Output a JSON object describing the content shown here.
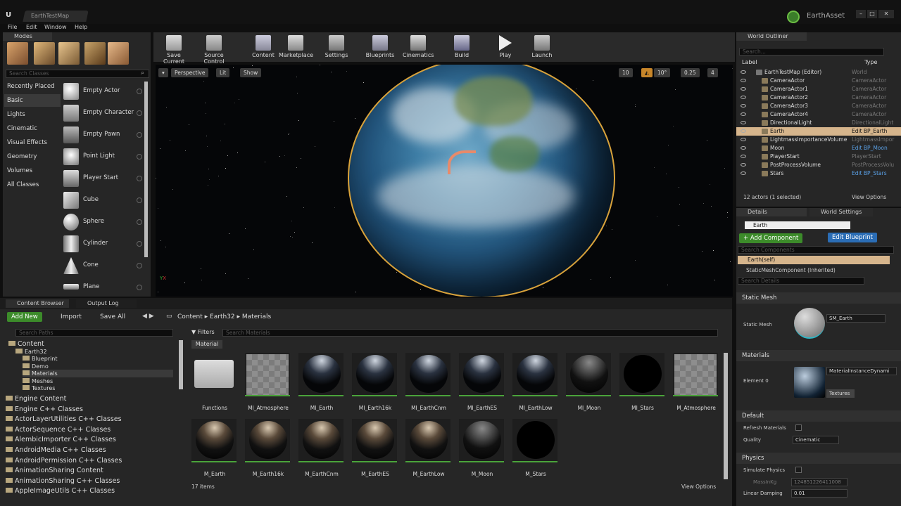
{
  "window": {
    "doc_tab": "EarthTestMap",
    "asset_name": "EarthAsset"
  },
  "menu": [
    "File",
    "Edit",
    "Window",
    "Help"
  ],
  "modes": {
    "tab": "Modes",
    "search_placeholder": "Search Classes",
    "categories": [
      "Recently Placed",
      "Basic",
      "Lights",
      "Cinematic",
      "Visual Effects",
      "Geometry",
      "Volumes",
      "All Classes"
    ],
    "active_category": "Basic",
    "items": [
      "Empty Actor",
      "Empty Character",
      "Empty Pawn",
      "Point Light",
      "Player Start",
      "Cube",
      "Sphere",
      "Cylinder",
      "Cone",
      "Plane"
    ]
  },
  "toolbar": [
    {
      "label": "Save Current",
      "icon": "save-icon"
    },
    {
      "label": "Source Control",
      "icon": "source-control-icon"
    },
    {
      "label": "Content",
      "icon": "content-icon"
    },
    {
      "label": "Marketplace",
      "icon": "marketplace-icon"
    },
    {
      "label": "Settings",
      "icon": "settings-icon"
    },
    {
      "label": "Blueprints",
      "icon": "blueprints-icon"
    },
    {
      "label": "Cinematics",
      "icon": "cinematics-icon"
    },
    {
      "label": "Build",
      "icon": "build-icon"
    },
    {
      "label": "Play",
      "icon": "play-icon"
    },
    {
      "label": "Launch",
      "icon": "launch-icon"
    }
  ],
  "viewport": {
    "perspective": "Perspective",
    "lit": "Lit",
    "show": "Show",
    "grid_snap": "10",
    "rot_snap": "10°",
    "scale_snap": "0.25",
    "cam_speed": "4"
  },
  "outliner": {
    "tab": "World Outliner",
    "search_placeholder": "Search...",
    "col_label": "Label",
    "col_type": "Type",
    "rows": [
      {
        "label": "EarthTestMap (Editor)",
        "type": "World"
      },
      {
        "label": "CameraActor",
        "type": "CameraActor"
      },
      {
        "label": "CameraActor1",
        "type": "CameraActor"
      },
      {
        "label": "CameraActor2",
        "type": "CameraActor"
      },
      {
        "label": "CameraActor3",
        "type": "CameraActor"
      },
      {
        "label": "CameraActor4",
        "type": "CameraActor"
      },
      {
        "label": "DirectionalLight",
        "type": "DirectionalLight"
      },
      {
        "label": "Earth",
        "type": "Edit BP_Earth"
      },
      {
        "label": "LightmassImportanceVolume",
        "type": "LightmassImpor"
      },
      {
        "label": "Moon",
        "type": "Edit BP_Moon"
      },
      {
        "label": "PlayerStart",
        "type": "PlayerStart"
      },
      {
        "label": "PostProcessVolume",
        "type": "PostProcessVolu"
      },
      {
        "label": "Stars",
        "type": "Edit BP_Stars"
      }
    ],
    "selected": "Earth",
    "footer": "12 actors (1 selected)",
    "view_options": "View Options"
  },
  "details": {
    "tab": "Details",
    "tab2": "World Settings",
    "name_value": "Earth",
    "add_component": "+ Add Component",
    "edit_blueprint": "Edit Blueprint",
    "search_components": "Search Components",
    "self": "Earth(self)",
    "component": "StaticMeshComponent (Inherited)",
    "search_details": "Search Details",
    "static_mesh_section": "Static Mesh",
    "static_mesh_label": "Static Mesh",
    "static_mesh_value": "SM_Earth",
    "materials_section": "Materials",
    "element_label": "Element 0",
    "element_value": "MaterialInstanceDynami",
    "textures": "Textures",
    "default_section": "Default",
    "refresh_materials": "Refresh Materials",
    "quality_label": "Quality",
    "quality_value": "Cinematic",
    "physics_section": "Physics",
    "simulate_physics": "Simulate Physics",
    "mass_label": "MassInKg",
    "mass_value": "124851226411008",
    "linear_damping": "Linear Damping",
    "linear_damping_value": "0.01"
  },
  "content_browser": {
    "tab": "Content Browser",
    "tab2": "Output Log",
    "add_new": "Add New",
    "import": "Import",
    "save_all": "Save All",
    "breadcrumb": [
      "Content",
      "Earth32",
      "Materials"
    ],
    "search_paths": "Search Paths",
    "filters": "Filters",
    "search_materials": "Search Materials",
    "filter_chip": "Material",
    "tree": [
      {
        "label": "Content",
        "level": 0
      },
      {
        "label": "Earth32",
        "level": 1
      },
      {
        "label": "Blueprint",
        "level": 2
      },
      {
        "label": "Demo",
        "level": 2
      },
      {
        "label": "Materials",
        "level": 2
      },
      {
        "label": "Meshes",
        "level": 2
      },
      {
        "label": "Textures",
        "level": 2
      }
    ],
    "classes": [
      "Engine Content",
      "Engine C++ Classes",
      "ActorLayerUtilities C++ Classes",
      "ActorSequence C++ Classes",
      "AlembicImporter C++ Classes",
      "AndroidMedia C++ Classes",
      "AndroidPermission C++ Classes",
      "AnimationSharing Content",
      "AnimationSharing C++ Classes",
      "AppleImageUtils C++ Classes"
    ],
    "assets_row1": [
      "Functions",
      "MI_Atmosphere",
      "MI_Earth",
      "MI_Earth16k",
      "MI_EarthCnm",
      "MI_EarthES",
      "MI_EarthLow",
      "MI_Moon",
      "MI_Stars",
      "M_Atmosphere"
    ],
    "assets_row2": [
      "M_Earth",
      "M_Earth16k",
      "M_EarthCnm",
      "M_EarthES",
      "M_EarthLow",
      "M_Moon",
      "M_Stars"
    ],
    "item_count": "17 items",
    "view_options": "View Options"
  },
  "colors": {
    "accent_green": "#3c8b2a",
    "accent_blue": "#2b6db5",
    "selection": "#d6b58c",
    "earth_rim": "#d9a23a"
  }
}
